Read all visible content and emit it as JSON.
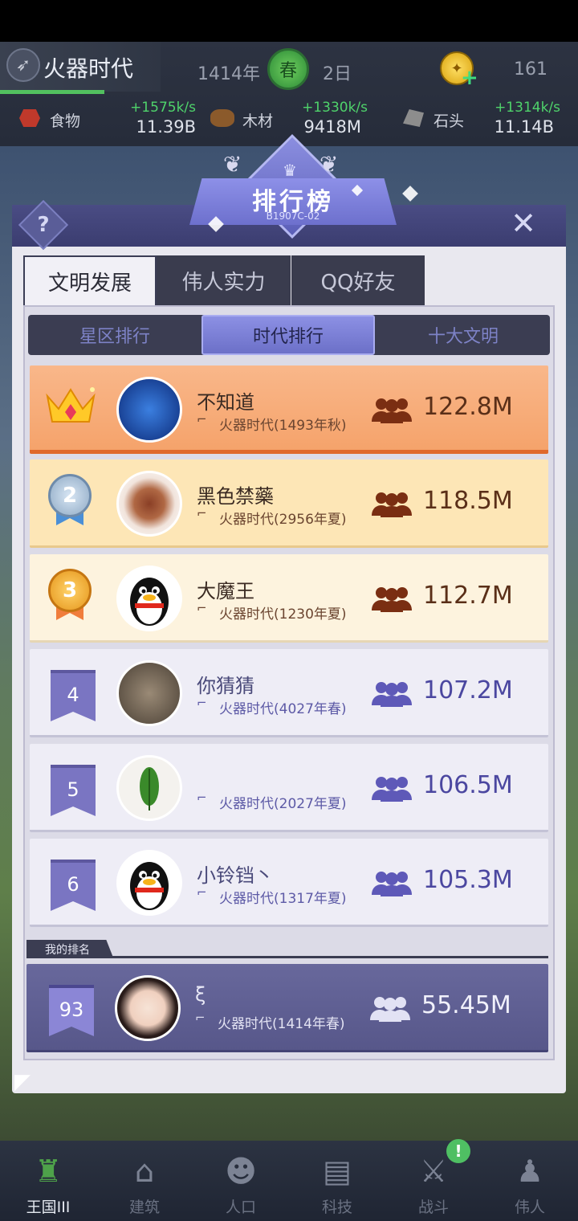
{
  "hud": {
    "era_name": "火器时代",
    "year": "1414年",
    "season": "春",
    "day": "2日",
    "coins": "161",
    "resources": [
      {
        "name": "食物",
        "rate": "+1575k/s",
        "amount": "11.39B",
        "color": "#c0392b"
      },
      {
        "name": "木材",
        "rate": "+1330k/s",
        "amount": "9418M",
        "color": "#8b5a2b"
      },
      {
        "name": "石头",
        "rate": "+1314k/s",
        "amount": "11.14B",
        "color": "#8d8d8d"
      }
    ]
  },
  "panel": {
    "title": "排行榜",
    "code": "B1907C-02",
    "help_icon": "?",
    "close_icon": "✕"
  },
  "main_tabs": [
    "文明发展",
    "伟人实力",
    "QQ好友"
  ],
  "sub_tabs": [
    "星区排行",
    "时代排行",
    "十大文明"
  ],
  "rows": [
    {
      "rank": "1",
      "name": "不知道",
      "era": "火器时代(1493年秋)",
      "power": "122.8M"
    },
    {
      "rank": "2",
      "name": "黑色禁藥",
      "era": "火器时代(2956年夏)",
      "power": "118.5M"
    },
    {
      "rank": "3",
      "name": "大魔王",
      "era": "火器时代(1230年夏)",
      "power": "112.7M"
    },
    {
      "rank": "4",
      "name": "你猜猜",
      "era": "火器时代(4027年春)",
      "power": "107.2M"
    },
    {
      "rank": "5",
      "name": "",
      "era": "火器时代(2027年夏)",
      "power": "106.5M"
    },
    {
      "rank": "6",
      "name": "小铃铛丶",
      "era": "火器时代(1317年夏)",
      "power": "105.3M"
    }
  ],
  "my_rank": {
    "label": "我的排名",
    "rank": "93",
    "name": "ξ",
    "era": "火器时代(1414年春)",
    "power": "55.45M"
  },
  "bottom_nav": [
    {
      "label": "王国III",
      "icon": "castle-icon"
    },
    {
      "label": "建筑",
      "icon": "house-icon"
    },
    {
      "label": "人口",
      "icon": "person-icon"
    },
    {
      "label": "科技",
      "icon": "book-icon"
    },
    {
      "label": "战斗",
      "icon": "swords-icon"
    },
    {
      "label": "伟人",
      "icon": "statue-icon"
    }
  ],
  "battle_badge": "!",
  "colors": {
    "accent": "#6c70c8",
    "first_row": "#f5a36b",
    "second_row": "#fde6b6",
    "third_row": "#fdf3de",
    "my_row": "#5f5f93"
  }
}
